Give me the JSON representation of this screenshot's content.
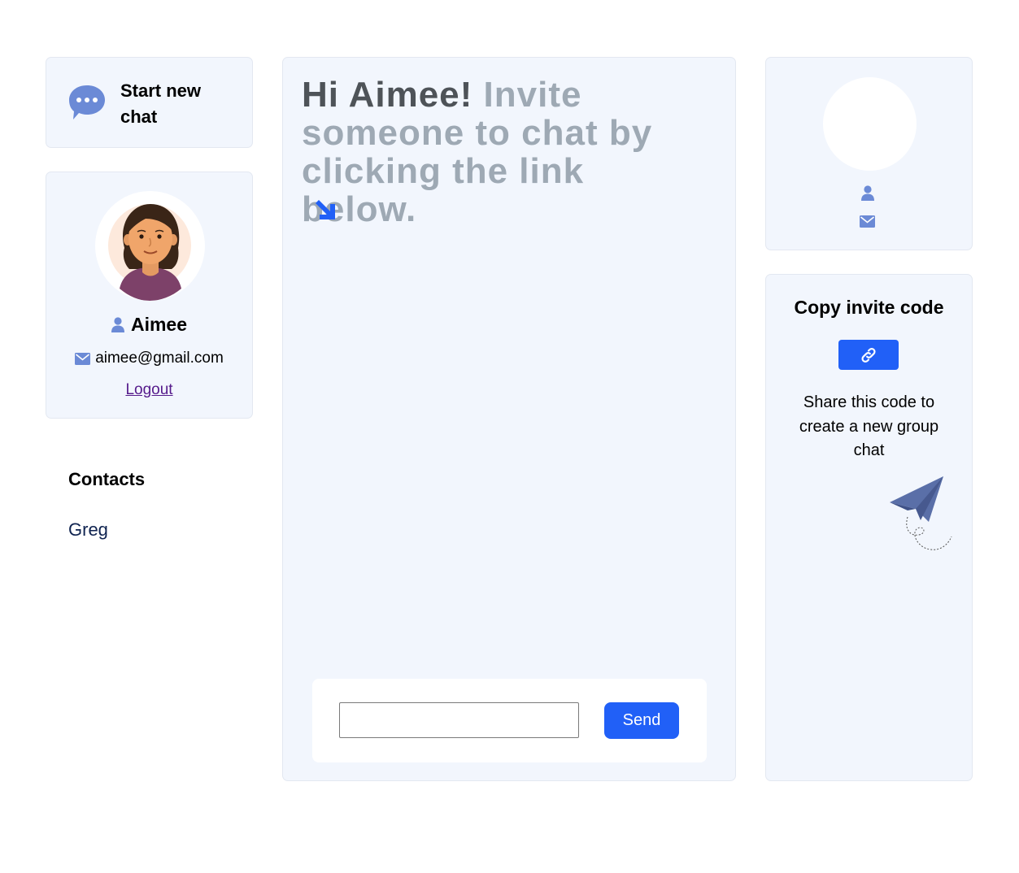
{
  "sidebar": {
    "start_chat_label": "Start new chat",
    "profile": {
      "name": "Aimee",
      "email": "aimee@gmail.com",
      "logout_label": "Logout"
    },
    "contacts_heading": "Contacts",
    "contacts": [
      "Greg"
    ]
  },
  "chat": {
    "greeting_hi": "Hi Aimee!",
    "greeting_rest": "Invite someone to chat by clicking the link below.",
    "input_value": "",
    "send_label": "Send"
  },
  "right_panel": {
    "invite_title": "Copy invite code",
    "invite_desc": "Share this code to create a new group chat"
  },
  "icons": {
    "start_chat": "chat-bubble-icon",
    "user": "user-icon",
    "email": "envelope-icon",
    "arrow": "arrow-down-right-icon",
    "link": "link-icon",
    "plane": "paper-plane-icon"
  },
  "colors": {
    "panel_bg": "#f2f6fd",
    "accent": "#2160f7",
    "icon_blue": "#6b8ad6",
    "greeting_dark": "#4e5358",
    "greeting_light": "#9ea9b4"
  }
}
